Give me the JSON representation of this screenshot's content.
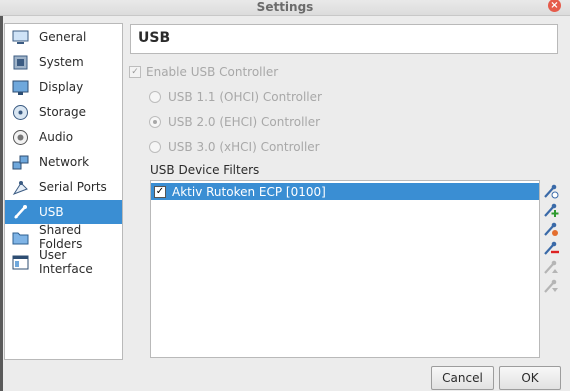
{
  "window": {
    "title": "Settings"
  },
  "sidebar": {
    "items": [
      {
        "label": "General",
        "icon": "general-icon"
      },
      {
        "label": "System",
        "icon": "system-icon"
      },
      {
        "label": "Display",
        "icon": "display-icon"
      },
      {
        "label": "Storage",
        "icon": "storage-icon"
      },
      {
        "label": "Audio",
        "icon": "audio-icon"
      },
      {
        "label": "Network",
        "icon": "network-icon"
      },
      {
        "label": "Serial Ports",
        "icon": "serial-ports-icon"
      },
      {
        "label": "USB",
        "icon": "usb-icon",
        "selected": true
      },
      {
        "label": "Shared Folders",
        "icon": "shared-folders-icon"
      },
      {
        "label": "User Interface",
        "icon": "user-interface-icon"
      }
    ]
  },
  "header": {
    "title": "USB"
  },
  "usb": {
    "enable_label": "Enable USB Controller",
    "enable_checked": true,
    "radio_1": "USB 1.1 (OHCI) Controller",
    "radio_2": "USB 2.0 (EHCI) Controller",
    "radio_3": "USB 3.0 (xHCI) Controller",
    "selected_radio": 2,
    "filters_label": "USB Device Filters",
    "filters": [
      {
        "label": "Aktiv Rutoken ECP [0100]",
        "checked": true
      }
    ]
  },
  "buttons": {
    "cancel": "Cancel",
    "ok": "OK"
  },
  "colors": {
    "selection": "#3a8ed3",
    "close": "#e55b4b"
  }
}
